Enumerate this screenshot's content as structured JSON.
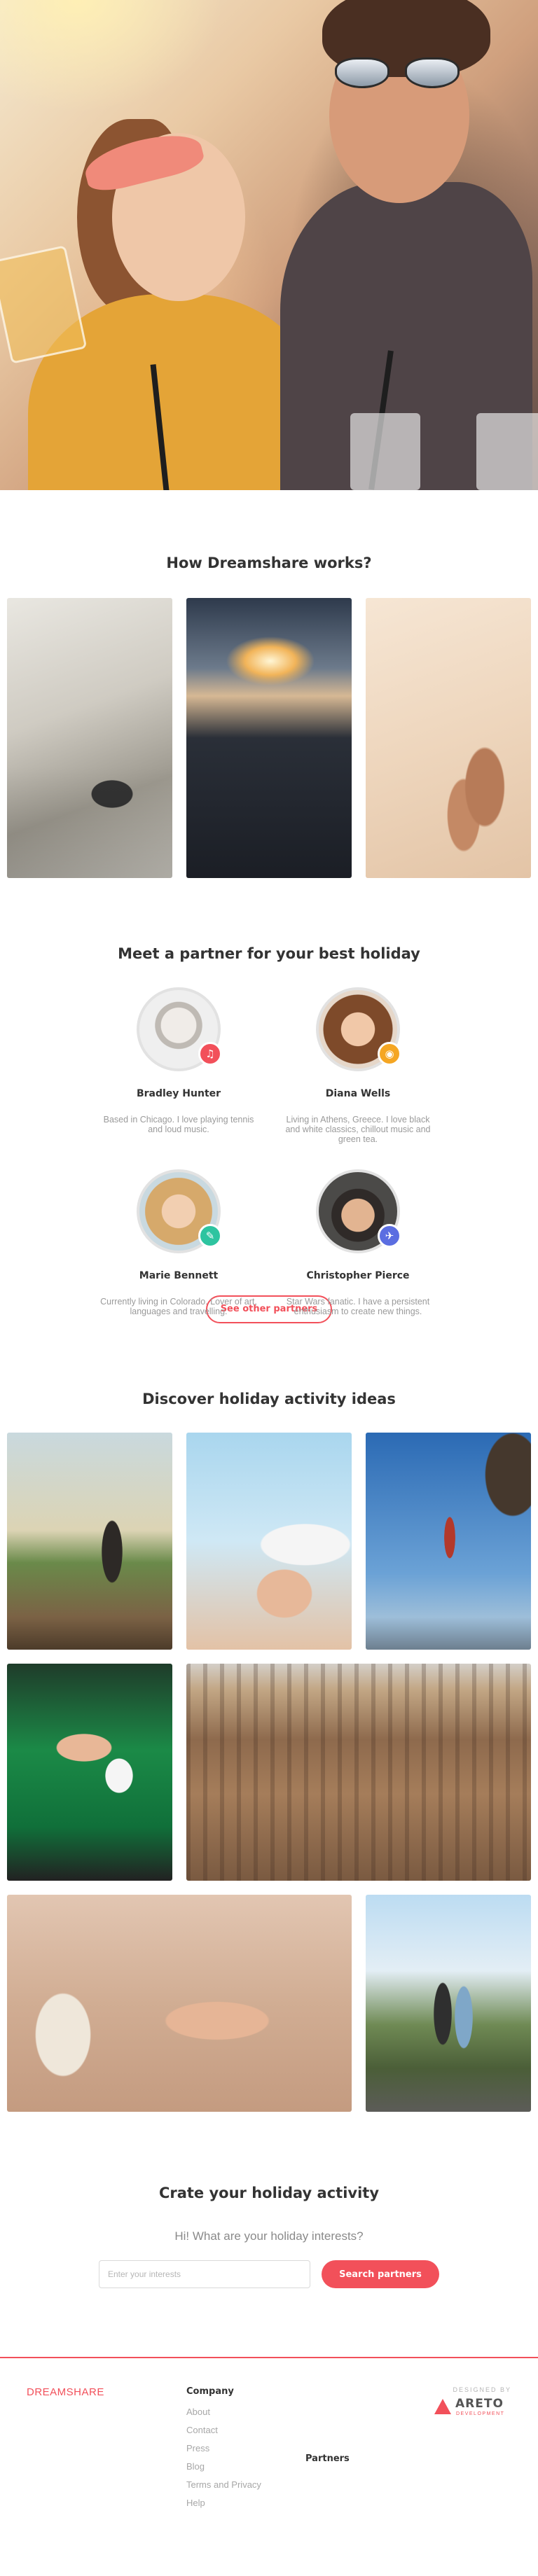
{
  "colors": {
    "accent": "#f2505a",
    "heading": "#333333",
    "muted": "#9a9a9a"
  },
  "hero": {
    "image": "hero-photo-friends-laughing"
  },
  "how_it_works": {
    "title": "How Dreamshare works?",
    "images": [
      "laptop-photo",
      "driving-photo",
      "beach-feet-photo"
    ]
  },
  "partners_section": {
    "title": "Meet a partner for your best holiday",
    "partners": [
      {
        "name": "Bradley Hunter",
        "bio": "Based in Chicago. I love playing tennis and loud music.",
        "icon": "music-icon",
        "icon_glyph": "♫"
      },
      {
        "name": "Diana Wells",
        "bio": "Living in Athens, Greece. I love black and white classics, chillout music and green tea.",
        "icon": "camera-icon",
        "icon_glyph": "◉"
      },
      {
        "name": "Marie Bennett",
        "bio": "Currently living in Colorado. Lover of art, languages and travelling.",
        "icon": "brush-icon",
        "icon_glyph": "✎"
      },
      {
        "name": "Christopher Pierce",
        "bio": "Star Wars fanatic. I have a persistent enthusiasm to create new things.",
        "icon": "plane-icon",
        "icon_glyph": "✈"
      }
    ],
    "more_button": "See other partners"
  },
  "activities": {
    "title": "Discover holiday activity ideas",
    "tiles": [
      "running-photo",
      "sun-hat-photo",
      "climbing-photo",
      "poker-photo",
      "colosseum-photo",
      "spa-photo",
      "hiking-photo"
    ]
  },
  "create": {
    "title": "Crate your holiday activity",
    "subtitle": "Hi! What are your holiday interests?",
    "input_placeholder": "Enter your interests",
    "input_value": "",
    "button": "Search partners"
  },
  "footer": {
    "brand": "DREAMSHARE",
    "company": {
      "title": "Company",
      "links": [
        "About",
        "Contact",
        "Press",
        "Blog",
        "Terms and Privacy",
        "Help"
      ]
    },
    "partners": {
      "title": "Partners"
    },
    "credit": {
      "label": "DESIGNED BY",
      "name": "ARETO",
      "sub": "DEVELOPMENT"
    }
  }
}
